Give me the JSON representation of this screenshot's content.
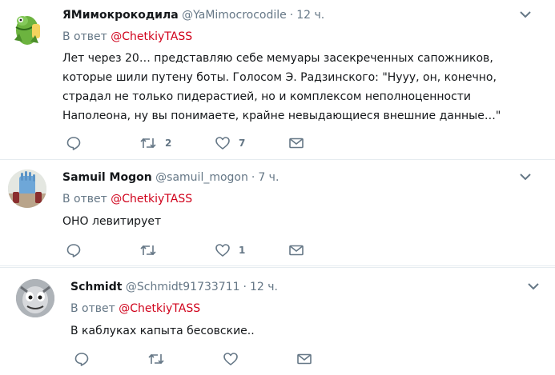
{
  "tweets": [
    {
      "name": "ЯМимокрокодила",
      "handle": "@YaMimocrocodile",
      "time": "12 ч.",
      "reply_prefix": "В ответ",
      "reply_mention": "@ChetkiyTASS",
      "text": "Лет через 20… представляю себе мемуары засекреченных сапожников, которые шили путену боты. Голосом Э. Радзинского: \"Нууу, он, конечно, страдал не только пидерастией, но и комплексом неполноценности Наполеона, ну вы понимаете, крайне невыдающиеся внешние данные…\"",
      "retweets": "2",
      "likes": "7"
    },
    {
      "name": "Samuil Mogon",
      "handle": "@samuil_mogon",
      "time": "7 ч.",
      "reply_prefix": "В ответ",
      "reply_mention": "@ChetkiyTASS",
      "text": "ОНО левитирует",
      "retweets": "",
      "likes": "1"
    },
    {
      "name": "Schmidt",
      "handle": "@Schmidt91733711",
      "time": "12 ч.",
      "reply_prefix": "В ответ",
      "reply_mention": "@ChetkiyTASS",
      "text": "В каблуках капыта бесовские..",
      "retweets": "",
      "likes": ""
    }
  ],
  "colors": {
    "mention": "#d0021b",
    "secondary_text": "#657786",
    "divider": "#e6ecf0",
    "icon": "#657786"
  },
  "icons": [
    "reply-icon",
    "retweet-icon",
    "like-icon",
    "dm-icon",
    "chevron-down-icon"
  ]
}
